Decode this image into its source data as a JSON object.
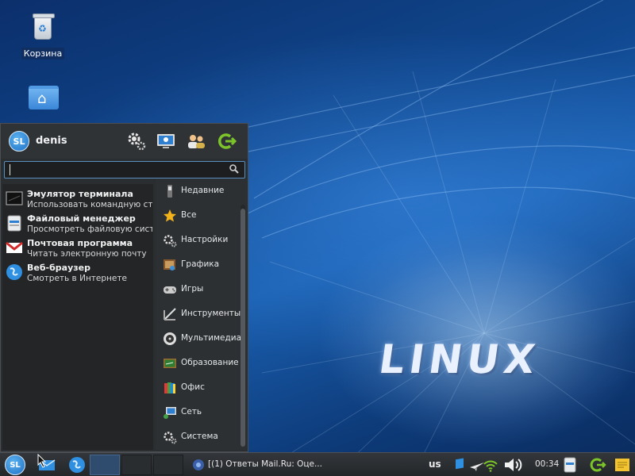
{
  "desktop": {
    "icons": [
      {
        "label": "Корзина",
        "icon": "trash-icon"
      },
      {
        "label": "",
        "icon": "home-folder-icon"
      }
    ],
    "wallpaper_text": "LINUX"
  },
  "menu": {
    "username": "denis",
    "avatar_text": "SL",
    "header_buttons": [
      "settings-icon",
      "display-icon",
      "users-icon",
      "logout-icon"
    ],
    "search": {
      "value": "",
      "placeholder": ""
    },
    "favorites": [
      {
        "title": "Эмулятор терминала",
        "desc": "Использовать командную ст...",
        "icon": "terminal-icon"
      },
      {
        "title": "Файловый менеджер",
        "desc": "Просмотреть файловую систе...",
        "icon": "file-manager-icon"
      },
      {
        "title": "Почтовая программа",
        "desc": "Читать электронную почту",
        "icon": "mail-icon"
      },
      {
        "title": "Веб-браузер",
        "desc": "Смотреть в Интернете",
        "icon": "web-browser-icon"
      }
    ],
    "categories": [
      {
        "label": "Недавние",
        "icon": "recent-icon"
      },
      {
        "label": "Все",
        "icon": "star-icon"
      },
      {
        "label": "Настройки",
        "icon": "settings-gears-icon"
      },
      {
        "label": "Графика",
        "icon": "graphics-icon"
      },
      {
        "label": "Игры",
        "icon": "gamepad-icon"
      },
      {
        "label": "Инструменты",
        "icon": "tools-icon"
      },
      {
        "label": "Мультимедиа",
        "icon": "multimedia-icon"
      },
      {
        "label": "Образование",
        "icon": "education-icon"
      },
      {
        "label": "Офис",
        "icon": "office-icon"
      },
      {
        "label": "Сеть",
        "icon": "network-icon"
      },
      {
        "label": "Система",
        "icon": "system-icon"
      }
    ]
  },
  "taskbar": {
    "start_text": "SL",
    "launchers": [
      "mail-launcher-icon",
      "browser-launcher-icon"
    ],
    "task": "[(1) Ответы Mail.Ru: Оце...",
    "keyboard_layout": "us",
    "clock": "00:34",
    "colors": {
      "accent": "#2f7fd0",
      "panel": "#2b2e31"
    }
  }
}
